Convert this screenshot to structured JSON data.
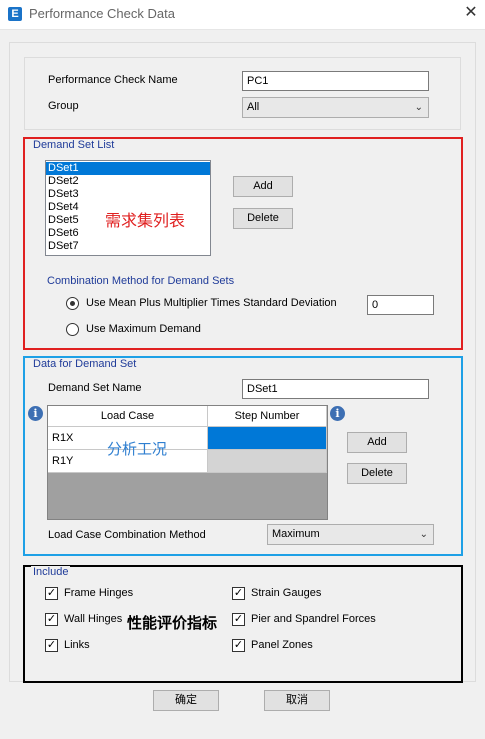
{
  "window": {
    "title": "Performance Check Data",
    "close_glyph": "✕",
    "app_icon_letter": "E"
  },
  "top": {
    "name_label": "Performance Check Name",
    "name_value": "PC1",
    "group_label": "Group",
    "group_value": "All"
  },
  "demand_set_list": {
    "title": "Demand Set List",
    "items": [
      "DSet1",
      "DSet2",
      "DSet3",
      "DSet4",
      "DSet5",
      "DSet6",
      "DSet7"
    ],
    "selected": "DSet1",
    "add_label": "Add",
    "delete_label": "Delete",
    "annotation": "需求集列表",
    "combination_title": "Combination Method for Demand Sets",
    "option_mean_label": "Use Mean Plus Multiplier Times Standard Deviation",
    "option_mean_value": "0",
    "option_max_label": "Use Maximum Demand",
    "selected_option": "mean"
  },
  "demand_set_data": {
    "title": "Data for Demand Set",
    "name_label": "Demand Set Name",
    "name_value": "DSet1",
    "columns": [
      "Load Case",
      "Step Number"
    ],
    "rows": [
      {
        "load_case": "R1X",
        "step_number": ""
      },
      {
        "load_case": "R1Y",
        "step_number": ""
      }
    ],
    "add_label": "Add",
    "delete_label": "Delete",
    "annotation": "分析工况",
    "combination_label": "Load Case Combination Method",
    "combination_value": "Maximum"
  },
  "include": {
    "title": "Include",
    "frame_hinges": "Frame Hinges",
    "wall_hinges": "Wall Hinges",
    "links": "Links",
    "strain_gauges": "Strain Gauges",
    "pier_spandrel": "Pier and Spandrel Forces",
    "panel_zones": "Panel Zones",
    "annotation": "性能评价指标",
    "checked": true
  },
  "footer": {
    "ok_label": "确定",
    "cancel_label": "取消"
  },
  "colors": {
    "selection": "#0078d7",
    "demand_list_border": "#e02020",
    "demand_data_border": "#1ea0e6",
    "include_border": "#000000",
    "section_title": "#1f3b99",
    "annotation_red": "#e02020",
    "annotation_blue": "#2f7fd0"
  }
}
